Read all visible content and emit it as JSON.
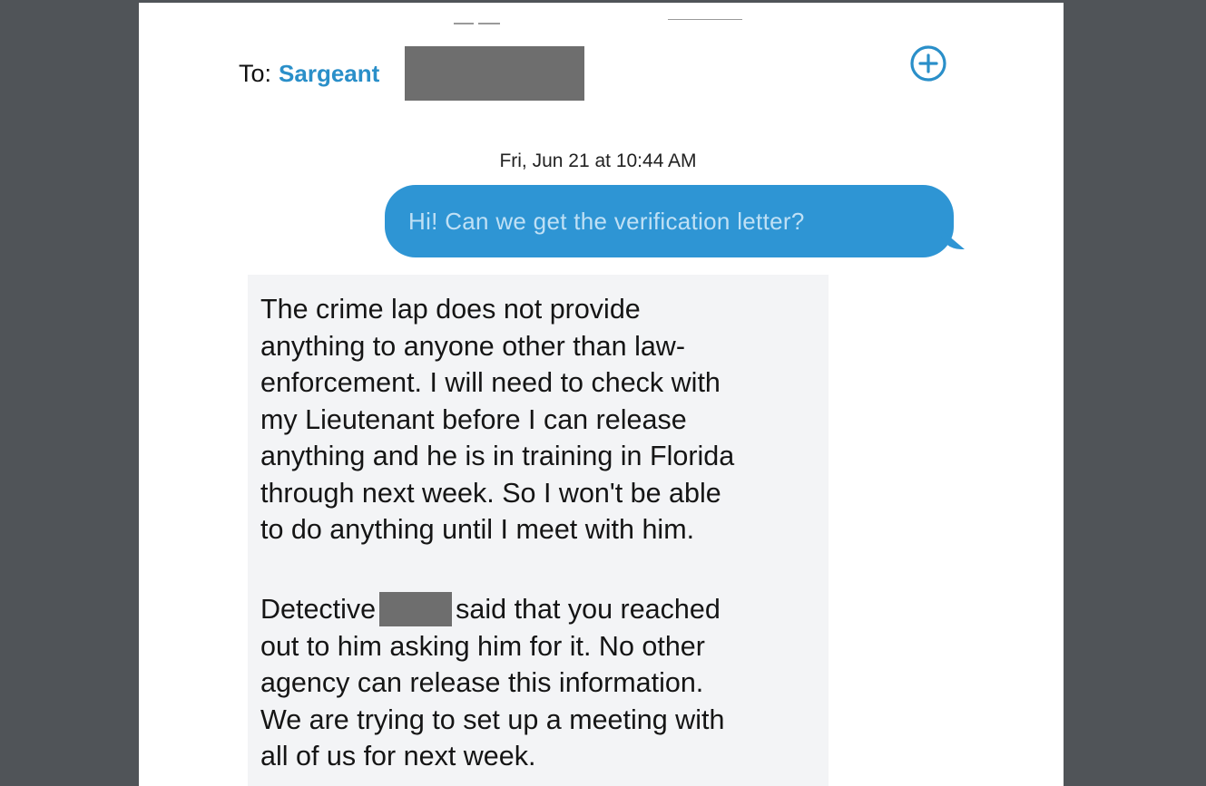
{
  "header": {
    "to_label": "To:",
    "recipient_name": "Sargeant",
    "add_icon": "plus-circle-icon"
  },
  "conversation": {
    "timestamp": "Fri, Jun 21 at 10:44 AM",
    "outgoing_message": "Hi! Can we get the verification letter?",
    "incoming_paragraph_1": [
      "The crime lap does not provide",
      "anything to anyone other than law-",
      "enforcement. I will need to check with",
      "my Lieutenant before I can release",
      "anything and he is in training in Florida",
      "through next week. So I won't be able",
      "to do anything until I meet with him."
    ],
    "incoming_paragraph_2": {
      "line1_before": "Detective",
      "line1_after": "said that you reached",
      "lines": [
        "out to him asking him for it. No other",
        "agency can release this information.",
        "We are trying to set up a meeting with",
        "all of us for next week."
      ]
    }
  },
  "colors": {
    "background": "#505458",
    "page": "#ffffff",
    "accent_blue": "#2e95d4",
    "recipient_blue": "#2a8fc9",
    "redaction_gray": "#6e6e6e",
    "incoming_bubble": "#f3f4f6"
  }
}
